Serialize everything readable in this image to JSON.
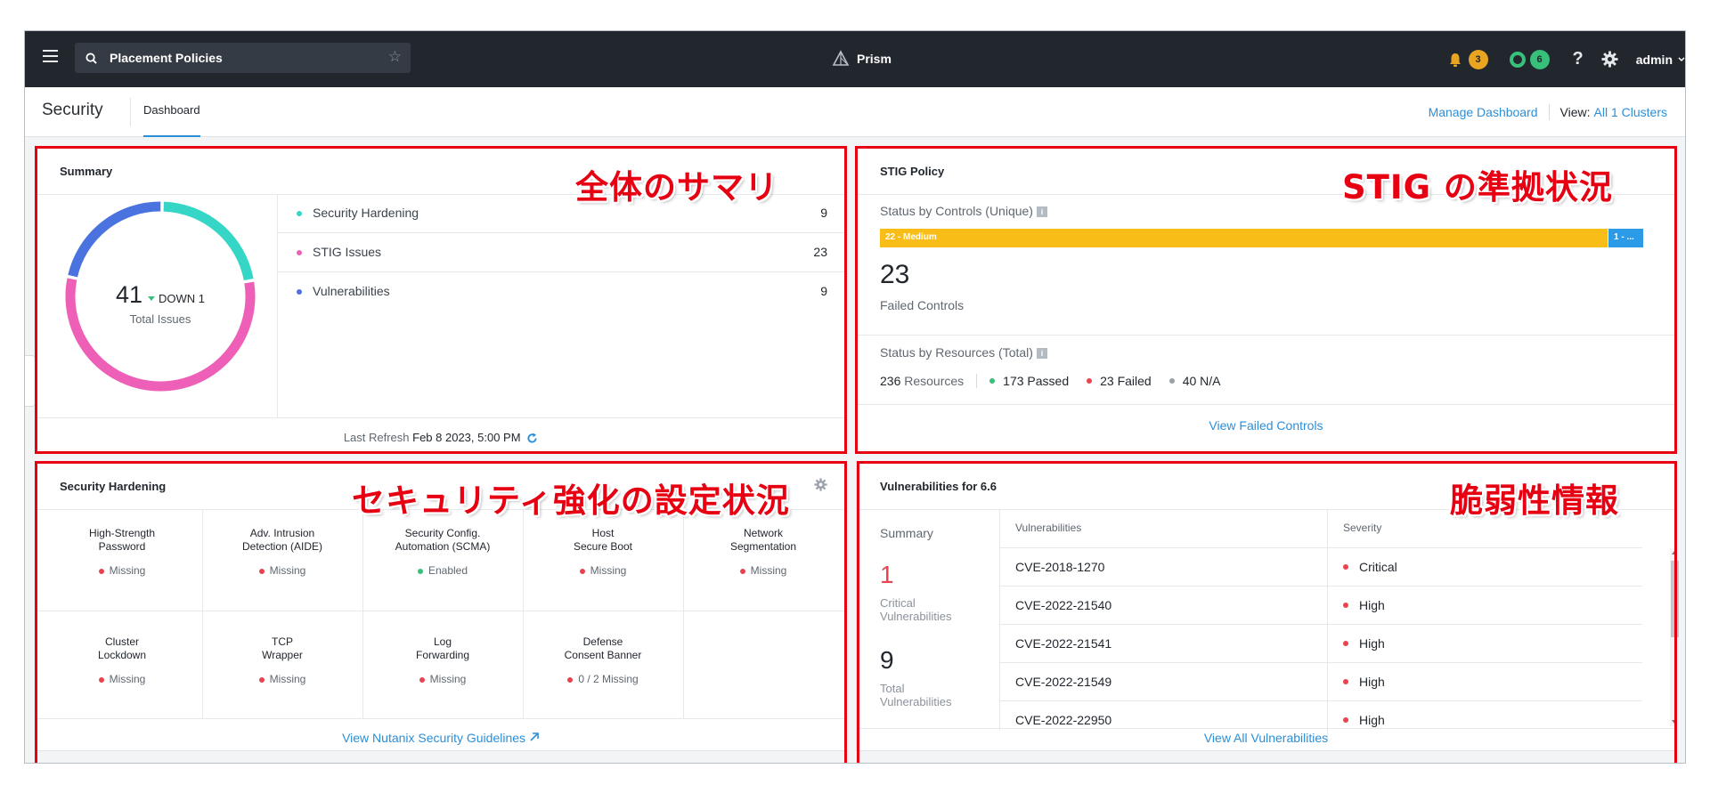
{
  "topbar": {
    "search_text": "Placement Policies",
    "brand": "Prism",
    "alerts_count": "3",
    "tasks_count": "6",
    "help": "?",
    "user": "admin"
  },
  "subheader": {
    "section": "Security",
    "tab": "Dashboard",
    "manage": "Manage Dashboard",
    "view_label": "View:",
    "view_value": "All 1 Clusters"
  },
  "summary": {
    "title": "Summary",
    "total": "41",
    "delta": "DOWN 1",
    "total_label": "Total Issues",
    "items": [
      {
        "label": "Security Hardening",
        "value": "9",
        "color": "#35d6c6"
      },
      {
        "label": "STIG Issues",
        "value": "23",
        "color": "#ee5fb8"
      },
      {
        "label": "Vulnerabilities",
        "value": "9",
        "color": "#4a73e0"
      }
    ],
    "refresh_label": "Last Refresh",
    "refresh_time": "Feb 8 2023, 5:00 PM",
    "annotation": "全体のサマリ"
  },
  "stig": {
    "title": "STIG Policy",
    "status_controls": "Status by Controls (Unique)",
    "bar_medium": "22 - Medium",
    "bar_other": "1 - ...",
    "failed_count": "23",
    "failed_label": "Failed Controls",
    "status_resources": "Status by Resources (Total)",
    "resources_count": "236",
    "resources_label": "Resources",
    "passed": "173 Passed",
    "failed": "23 Failed",
    "na": "40 N/A",
    "footer": "View Failed Controls",
    "annotation": "STIG の準拠状況"
  },
  "hardening": {
    "title": "Security Hardening",
    "items": [
      {
        "name1": "High-Strength",
        "name2": "Password",
        "status": "Missing",
        "color": "#e8444f"
      },
      {
        "name1": "Adv. Intrusion",
        "name2": "Detection (AIDE)",
        "status": "Missing",
        "color": "#e8444f"
      },
      {
        "name1": "Security Config.",
        "name2": "Automation (SCMA)",
        "status": "Enabled",
        "color": "#36c07a"
      },
      {
        "name1": "Host",
        "name2": "Secure Boot",
        "status": "Missing",
        "color": "#e8444f"
      },
      {
        "name1": "Network",
        "name2": "Segmentation",
        "status": "Missing",
        "color": "#e8444f"
      },
      {
        "name1": "Cluster",
        "name2": "Lockdown",
        "status": "Missing",
        "color": "#e8444f"
      },
      {
        "name1": "TCP",
        "name2": "Wrapper",
        "status": "Missing",
        "color": "#e8444f"
      },
      {
        "name1": "Log",
        "name2": "Forwarding",
        "status": "Missing",
        "color": "#e8444f"
      },
      {
        "name1": "Defense",
        "name2": "Consent Banner",
        "status": "0 / 2 Missing",
        "color": "#e8444f"
      }
    ],
    "footer": "View Nutanix Security Guidelines",
    "annotation": "セキュリティ強化の設定状況"
  },
  "vulns": {
    "title": "Vulnerabilities for 6.6",
    "summary_label": "Summary",
    "critical_count": "1",
    "critical_label1": "Critical",
    "critical_label2": "Vulnerabilities",
    "total_count": "9",
    "total_label1": "Total",
    "total_label2": "Vulnerabilities",
    "col_vuln": "Vulnerabilities",
    "col_sev": "Severity",
    "rows": [
      {
        "cve": "CVE-2018-1270",
        "severity": "Critical"
      },
      {
        "cve": "CVE-2022-21540",
        "severity": "High"
      },
      {
        "cve": "CVE-2022-21541",
        "severity": "High"
      },
      {
        "cve": "CVE-2022-21549",
        "severity": "High"
      },
      {
        "cve": "CVE-2022-22950",
        "severity": "High"
      }
    ],
    "footer": "View All Vulnerabilities",
    "annotation": "脆弱性情報"
  },
  "colors": {
    "red": "#e8444f",
    "green": "#36c07a",
    "grey": "#9aa1a9",
    "link": "#2b8fd8",
    "annotation": "#e60012",
    "medium": "#f8bd17"
  }
}
